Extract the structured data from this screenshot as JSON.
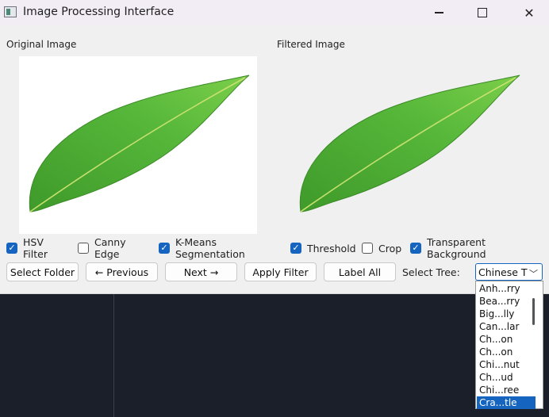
{
  "window": {
    "title": "Image Processing Interface",
    "controls": {
      "minimize": "minimize-icon",
      "maximize": "maximize-icon",
      "close": "close-icon"
    }
  },
  "panels": {
    "original_label": "Original Image",
    "filtered_label": "Filtered Image"
  },
  "filters": [
    {
      "label": "HSV Filter",
      "checked": true
    },
    {
      "label": "Canny Edge",
      "checked": false
    },
    {
      "label": "K-Means Segmentation",
      "checked": true
    },
    {
      "label": "Threshold",
      "checked": true
    },
    {
      "label": "Crop",
      "checked": false
    },
    {
      "label": "Transparent Background",
      "checked": true
    }
  ],
  "buttons": {
    "select_folder": "Select Folder",
    "previous": "← Previous",
    "next": "Next →",
    "apply_filter": "Apply Filter",
    "label_all": "Label All"
  },
  "tree_select": {
    "label": "Select Tree:",
    "value": "Chinese T",
    "options": [
      "Anh...rry",
      "Bea...rry",
      "Big...lly",
      "Can...lar",
      "Ch...on",
      "Ch...on",
      "Chi...nut",
      "Ch...ud",
      "Chi...ree",
      "Cra...tle"
    ],
    "selected_index": 9
  },
  "colors": {
    "accent": "#1565c0",
    "leaf": "#4caf2a"
  }
}
